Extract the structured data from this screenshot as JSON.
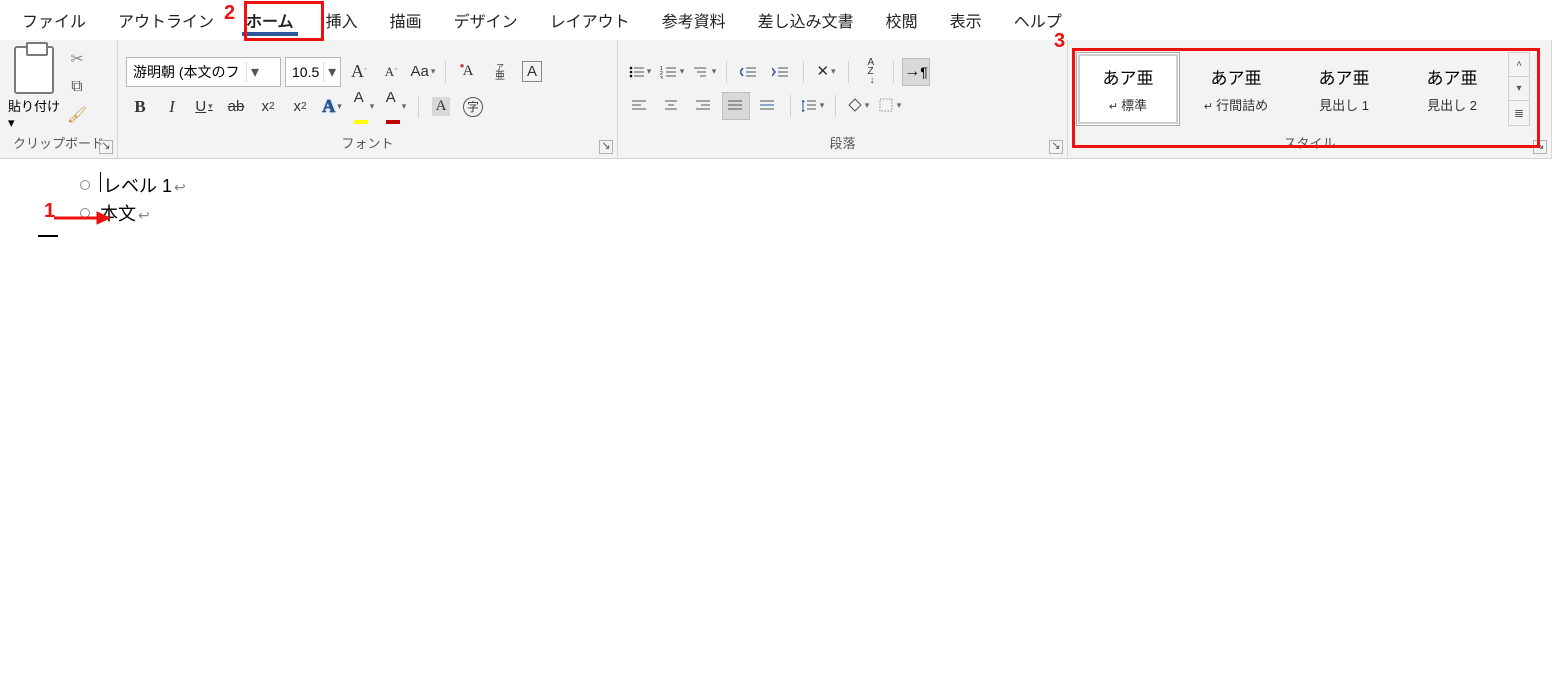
{
  "tabs": {
    "file": "ファイル",
    "outline": "アウトライン",
    "home": "ホーム",
    "insert": "挿入",
    "draw": "描画",
    "design": "デザイン",
    "layout": "レイアウト",
    "references": "参考資料",
    "mailings": "差し込み文書",
    "review": "校閲",
    "view": "表示",
    "help": "ヘルプ",
    "active": "home"
  },
  "clipboard": {
    "paste": "貼り付け",
    "title": "クリップボード"
  },
  "font": {
    "name": "游明朝 (本文のフ",
    "size": "10.5",
    "aa": "Aa",
    "title": "フォント",
    "bold": "B",
    "italic": "I",
    "underline": "U",
    "strike": "ab",
    "sub": "x",
    "sup": "x",
    "textfxA": "A",
    "highlightA": "A",
    "colorA": "A",
    "clearA": "A",
    "shadeA": "A",
    "circled": "字",
    "box": "A",
    "bigA": "A",
    "smallA": "A",
    "phon_top": "ア",
    "phon_bot": "亜"
  },
  "paragraph": {
    "title": "段落",
    "sortA": "A",
    "sortZ": "Z",
    "pilcrow": "¶"
  },
  "styles": {
    "title": "スタイル",
    "sample": "あア亜",
    "s1": "標準",
    "s2": "行間詰め",
    "s3": "見出し 1",
    "s4": "見出し 2"
  },
  "doc": {
    "line1": "レベル 1",
    "line2": "本文",
    "return": "↩"
  },
  "ann": {
    "n1": "1",
    "n2": "2",
    "n3": "3"
  },
  "icons": {
    "down": "▾",
    "scissors": "✂",
    "copy": "⧉",
    "brush": "🖌",
    "more": "⌄",
    "up": "˄"
  }
}
